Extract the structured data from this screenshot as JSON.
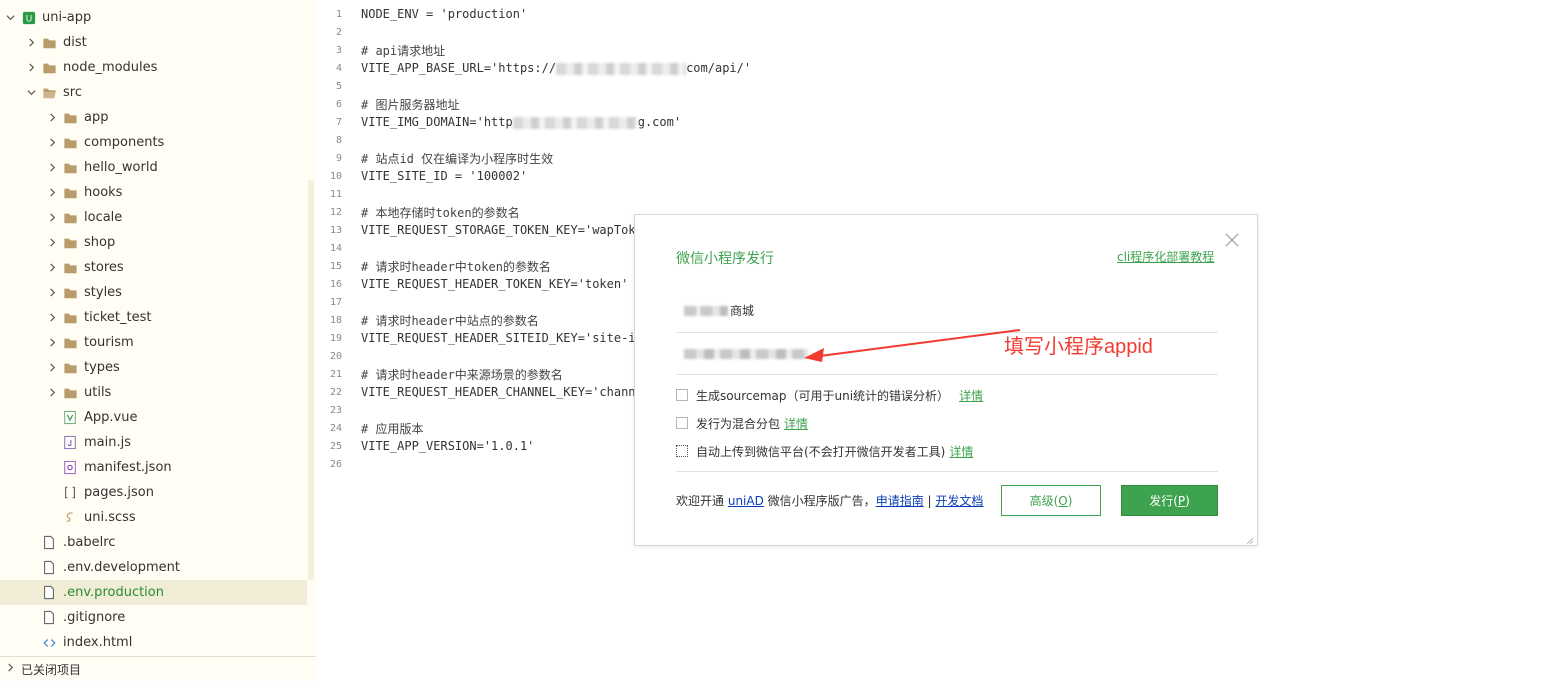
{
  "sidebar": {
    "project": "uni-app",
    "tree": [
      {
        "label": "dist",
        "type": "folder",
        "depth": 1,
        "expanded": false
      },
      {
        "label": "node_modules",
        "type": "folder",
        "depth": 1,
        "expanded": false
      },
      {
        "label": "src",
        "type": "folder",
        "depth": 1,
        "expanded": true
      },
      {
        "label": "app",
        "type": "folder",
        "depth": 2,
        "expanded": false
      },
      {
        "label": "components",
        "type": "folder",
        "depth": 2,
        "expanded": false
      },
      {
        "label": "hello_world",
        "type": "folder",
        "depth": 2,
        "expanded": false
      },
      {
        "label": "hooks",
        "type": "folder",
        "depth": 2,
        "expanded": false
      },
      {
        "label": "locale",
        "type": "folder",
        "depth": 2,
        "expanded": false
      },
      {
        "label": "shop",
        "type": "folder",
        "depth": 2,
        "expanded": false
      },
      {
        "label": "stores",
        "type": "folder",
        "depth": 2,
        "expanded": false
      },
      {
        "label": "styles",
        "type": "folder",
        "depth": 2,
        "expanded": false
      },
      {
        "label": "ticket_test",
        "type": "folder",
        "depth": 2,
        "expanded": false
      },
      {
        "label": "tourism",
        "type": "folder",
        "depth": 2,
        "expanded": false
      },
      {
        "label": "types",
        "type": "folder",
        "depth": 2,
        "expanded": false
      },
      {
        "label": "utils",
        "type": "folder",
        "depth": 2,
        "expanded": false
      },
      {
        "label": "App.vue",
        "type": "vue",
        "depth": 2
      },
      {
        "label": "main.js",
        "type": "js",
        "depth": 2
      },
      {
        "label": "manifest.json",
        "type": "manifest",
        "depth": 2
      },
      {
        "label": "pages.json",
        "type": "json",
        "depth": 2
      },
      {
        "label": "uni.scss",
        "type": "scss",
        "depth": 2
      },
      {
        "label": ".babelrc",
        "type": "file",
        "depth": 1
      },
      {
        "label": ".env.development",
        "type": "file",
        "depth": 1
      },
      {
        "label": ".env.production",
        "type": "file",
        "depth": 1,
        "selected": true
      },
      {
        "label": ".gitignore",
        "type": "file",
        "depth": 1
      },
      {
        "label": "index.html",
        "type": "html",
        "depth": 1
      }
    ],
    "closed_projects": "已关闭项目"
  },
  "editor": {
    "lines": [
      {
        "n": "1",
        "text": "NODE_ENV = 'production'"
      },
      {
        "n": "2",
        "text": ""
      },
      {
        "n": "3",
        "text": "# api请求地址"
      },
      {
        "n": "4",
        "text": "VITE_APP_BASE_URL='https://",
        "blurred_tail": "com/api/'"
      },
      {
        "n": "5",
        "text": ""
      },
      {
        "n": "6",
        "text": "# 图片服务器地址"
      },
      {
        "n": "7",
        "text": "VITE_IMG_DOMAIN='http",
        "blurred_tail": "g.com'"
      },
      {
        "n": "8",
        "text": ""
      },
      {
        "n": "9",
        "text": "# 站点id 仅在编译为小程序时生效"
      },
      {
        "n": "10",
        "text": "VITE_SITE_ID = '100002'"
      },
      {
        "n": "11",
        "text": ""
      },
      {
        "n": "12",
        "text": "# 本地存储时token的参数名"
      },
      {
        "n": "13",
        "text": "VITE_REQUEST_STORAGE_TOKEN_KEY='wapToke"
      },
      {
        "n": "14",
        "text": ""
      },
      {
        "n": "15",
        "text": "# 请求时header中token的参数名"
      },
      {
        "n": "16",
        "text": "VITE_REQUEST_HEADER_TOKEN_KEY='token'"
      },
      {
        "n": "17",
        "text": ""
      },
      {
        "n": "18",
        "text": "# 请求时header中站点的参数名"
      },
      {
        "n": "19",
        "text": "VITE_REQUEST_HEADER_SITEID_KEY='site-id"
      },
      {
        "n": "20",
        "text": ""
      },
      {
        "n": "21",
        "text": "# 请求时header中来源场景的参数名"
      },
      {
        "n": "22",
        "text": "VITE_REQUEST_HEADER_CHANNEL_KEY='channe"
      },
      {
        "n": "23",
        "text": ""
      },
      {
        "n": "24",
        "text": "# 应用版本"
      },
      {
        "n": "25",
        "text": "VITE_APP_VERSION='1.0.1'"
      },
      {
        "n": "26",
        "text": ""
      }
    ]
  },
  "dialog": {
    "title": "微信小程序发行",
    "tutorial_link": "cli程序化部署教程",
    "app_name_value": "商城",
    "options": [
      {
        "label": "生成sourcemap（可用于uni统计的错误分析）",
        "link": "详情"
      },
      {
        "label": "发行为混合分包",
        "link": "详情"
      },
      {
        "label": "自动上传到微信平台(不会打开微信开发者工具)",
        "link": "详情"
      }
    ],
    "footer": {
      "prefix": "欢迎开通",
      "uniad": "uniAD",
      "middle": "微信小程序版广告，",
      "guide": "申请指南",
      "sep": "|",
      "docs": "开发文档"
    },
    "advanced_button": "高级(",
    "advanced_key": "O",
    "publish_button": "发行(",
    "publish_key": "P",
    "close_paren": ")"
  },
  "annotation": {
    "text": "填写小程序appid",
    "color": "#f13b2f"
  },
  "colors": {
    "accent": "#3ea34e",
    "sidebar_bg": "#fffdf4",
    "selected_bg": "#f1ecd5"
  }
}
